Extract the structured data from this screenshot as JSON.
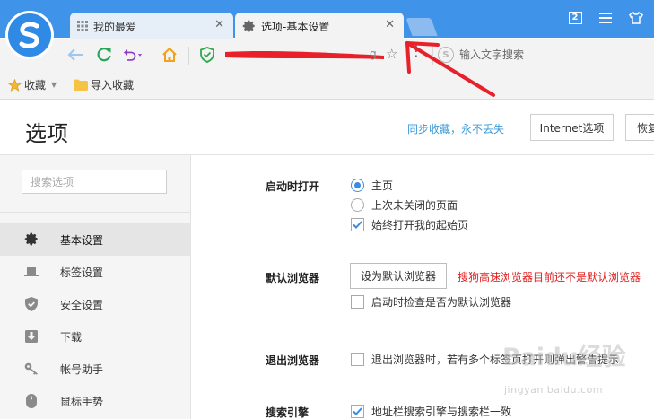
{
  "tabs": [
    {
      "label": "我的最爱",
      "icon": "grid-icon"
    },
    {
      "label": "选项-基本设置",
      "icon": "gear-icon"
    }
  ],
  "window_controls": {
    "tab_count_badge": "2"
  },
  "addressbar": {
    "url_tail": "g",
    "search_placeholder": "输入文字搜索",
    "search_engine_glyph": "S"
  },
  "bookmarks_bar": {
    "items": [
      {
        "label": "收藏",
        "icon": "star-icon"
      },
      {
        "label": "导入收藏",
        "icon": "folder-icon"
      }
    ]
  },
  "page": {
    "title": "选项",
    "sync_link": "同步收藏，永不丢失",
    "internet_options_button": "Internet选项",
    "restore_button": "恢复"
  },
  "sidebar": {
    "search_placeholder": "搜索选项",
    "items": [
      {
        "label": "基本设置",
        "icon": "gear-icon",
        "active": true
      },
      {
        "label": "标签设置",
        "icon": "tab-icon",
        "active": false
      },
      {
        "label": "安全设置",
        "icon": "shield-icon",
        "active": false
      },
      {
        "label": "下载",
        "icon": "download-icon",
        "active": false
      },
      {
        "label": "帐号助手",
        "icon": "key-icon",
        "active": false
      },
      {
        "label": "鼠标手势",
        "icon": "mouse-icon",
        "active": false
      }
    ]
  },
  "content": {
    "startup": {
      "label": "启动时打开",
      "options": [
        {
          "label": "主页",
          "type": "radio",
          "checked": true
        },
        {
          "label": "上次未关闭的页面",
          "type": "radio",
          "checked": false
        },
        {
          "label": "始终打开我的起始页",
          "type": "checkbox",
          "checked": true
        }
      ]
    },
    "default_browser": {
      "label": "默认浏览器",
      "button": "设为默认浏览器",
      "warning": "搜狗高速浏览器目前还不是默认浏览器",
      "check_option": {
        "label": "启动时检查是否为默认浏览器",
        "checked": false
      }
    },
    "exit_browser": {
      "label": "退出浏览器",
      "option": {
        "label": "退出浏览器时，若有多个标签页打开则弹出警告提示",
        "checked": false
      }
    },
    "search_engine": {
      "label": "搜索引擎",
      "option": {
        "label": "地址栏搜索引擎与搜索栏一致",
        "checked": true
      }
    }
  },
  "watermark": {
    "logo_text": "Baidu经验",
    "url": "jingyan.baidu.com"
  },
  "colors": {
    "titlebar": "#3f93e8",
    "accent": "#3c8be0",
    "link": "#3c9ad8",
    "warning": "#e02020",
    "annotation": "#e8202a"
  }
}
